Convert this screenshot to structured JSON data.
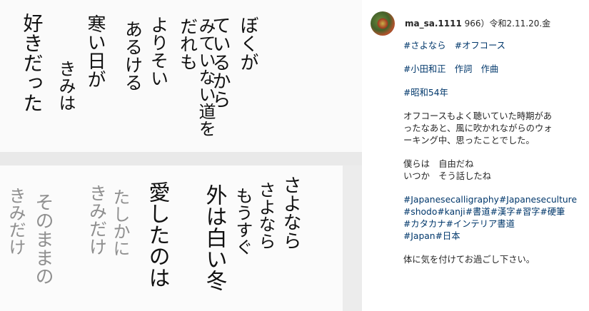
{
  "post": {
    "username": "ma_sa.1111",
    "header_suffix": " 966）令和2.11.20.金"
  },
  "caption": {
    "line1": "#さよなら　#オフコース",
    "line2": "#小田和正　作詞　作曲",
    "line3": "#昭和54年",
    "para1": [
      "オフコースもよく聴いていた時期があ",
      "ったなあと、風に吹かれながらのウォ",
      "ーキング中、思ったことでした。"
    ],
    "para2": [
      "僕らは　自由だね",
      "いつか　そう話したね"
    ],
    "tags": [
      "#Japanesecalligraphy#Japaneseculture",
      "#shodo#kanji#書道#漢字#習字#硬筆",
      "#カタカナ#インテリア書道",
      "#Japan#日本"
    ],
    "closing": "体に気を付けてお過ごし下さい。"
  },
  "artwork": {
    "top_columns": [
      "ぼくが",
      "ているから",
      "だれも",
      "みていない道を",
      "よりそい",
      "あるける",
      "寒い日が",
      "きみは",
      "好きだった"
    ],
    "bottom_columns": [
      "さよなら",
      "さよなら",
      "もうすぐ",
      "外は白い冬",
      "愛したのは",
      "たしかに",
      "きみだけ",
      "そのままの",
      "きみだけ"
    ]
  },
  "colors": {
    "link": "#00376b",
    "text": "#262626",
    "ink": "#111111"
  }
}
